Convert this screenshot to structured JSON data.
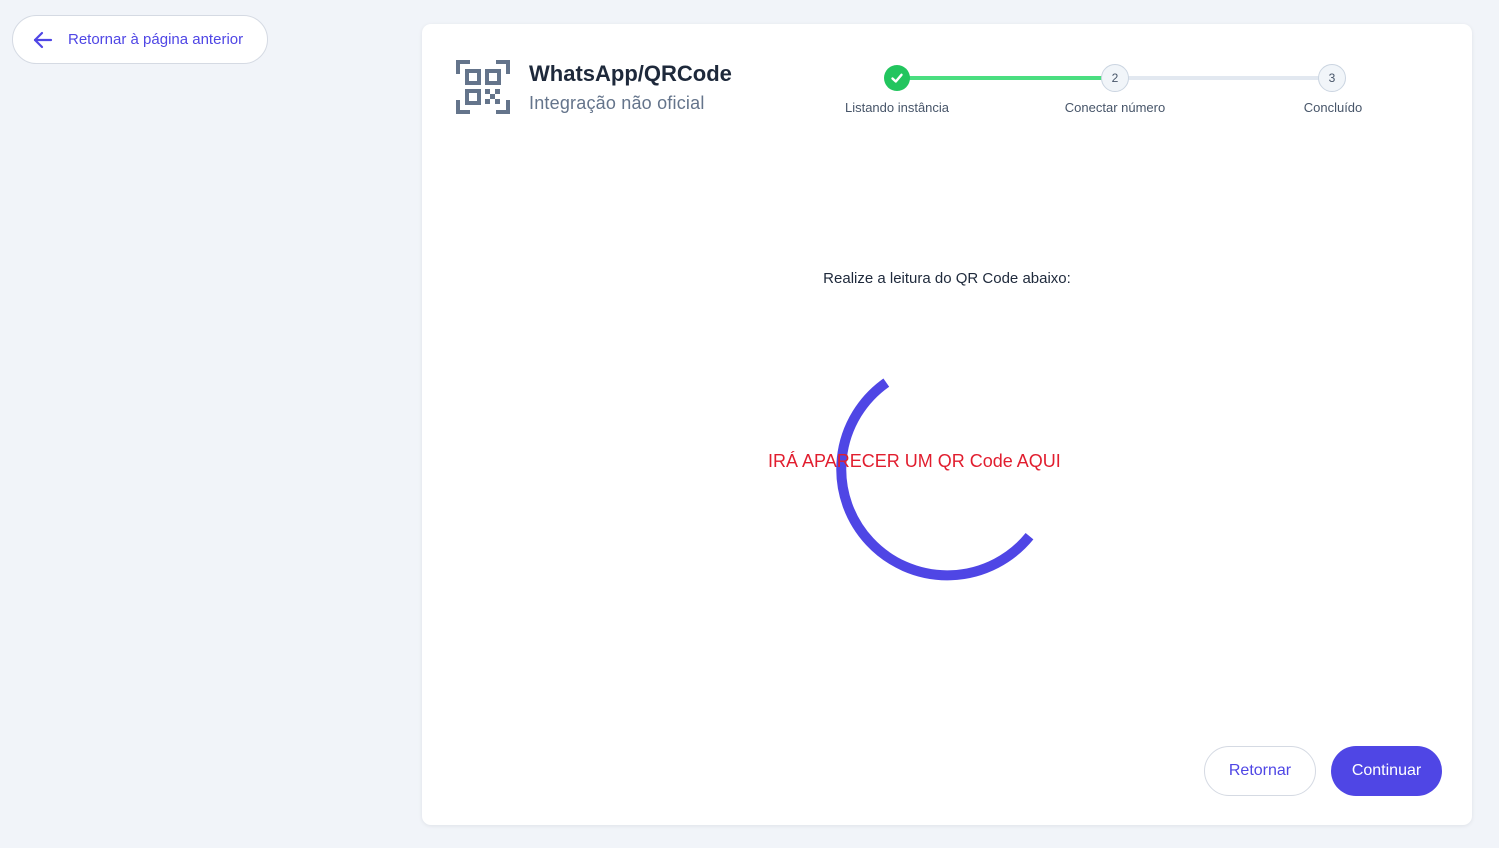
{
  "nav": {
    "back_label": "Retornar à página anterior"
  },
  "header": {
    "title": "WhatsApp/QRCode",
    "subtitle": "Integração não oficial",
    "icon": "qr-code-icon"
  },
  "stepper": {
    "steps": [
      {
        "number": "1",
        "label": "Listando instância",
        "status": "complete"
      },
      {
        "number": "2",
        "label": "Conectar número",
        "status": "pending"
      },
      {
        "number": "3",
        "label": "Concluído",
        "status": "pending"
      }
    ]
  },
  "main": {
    "instruction": "Realize a leitura do QR Code abaixo:",
    "qr_placeholder": "IRÁ APARECER UM QR Code AQUI"
  },
  "footer": {
    "back_label": "Retornar",
    "continue_label": "Continuar"
  },
  "colors": {
    "accent": "#4f46e5",
    "success": "#22c55e",
    "progress": "#4ade80",
    "placeholder_text": "#e11d2e",
    "background": "#f1f4f9"
  }
}
